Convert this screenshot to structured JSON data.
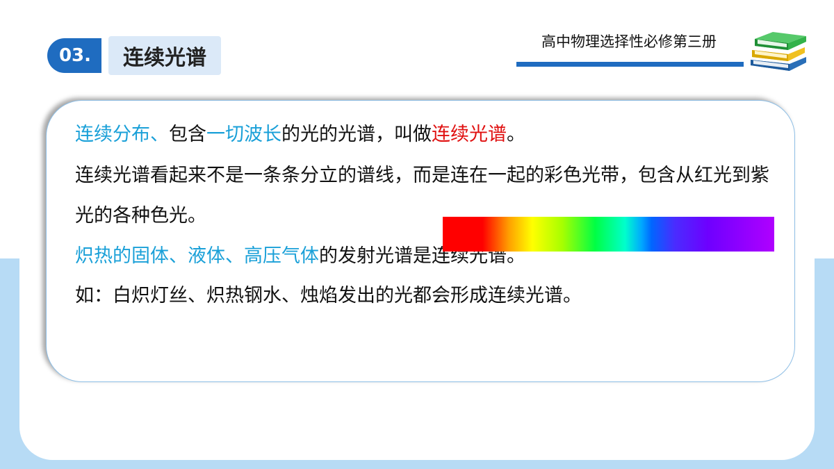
{
  "header": {
    "section_number": "03.",
    "section_title": "连续光谱",
    "book_title": "高中物理选择性必修第三册",
    "books_icon": "stacked-books-icon"
  },
  "content": {
    "line1": {
      "p1": "连续分布、",
      "p2": "包含",
      "p3": "一切波长",
      "p4": "的光的光谱，叫做",
      "p5": "连续光谱",
      "p6": "。"
    },
    "line2": "连续光谱看起来不是一条条分立的谱线，而是连在一起的彩色光带，包含从红光到紫光的各种色光。",
    "line3": {
      "p1": "炽热的固体、液体、高压气体",
      "p2": "的发射光谱是连续光谱。"
    },
    "line4": "如：白炽灯丝、炽热钢水、烛焰发出的光都会形成连续光谱。"
  },
  "colors": {
    "accent_blue": "#1f6cc0",
    "highlight_blue": "#1aa0d8",
    "highlight_red": "#e01010",
    "background_band": "#b7dbf5"
  }
}
